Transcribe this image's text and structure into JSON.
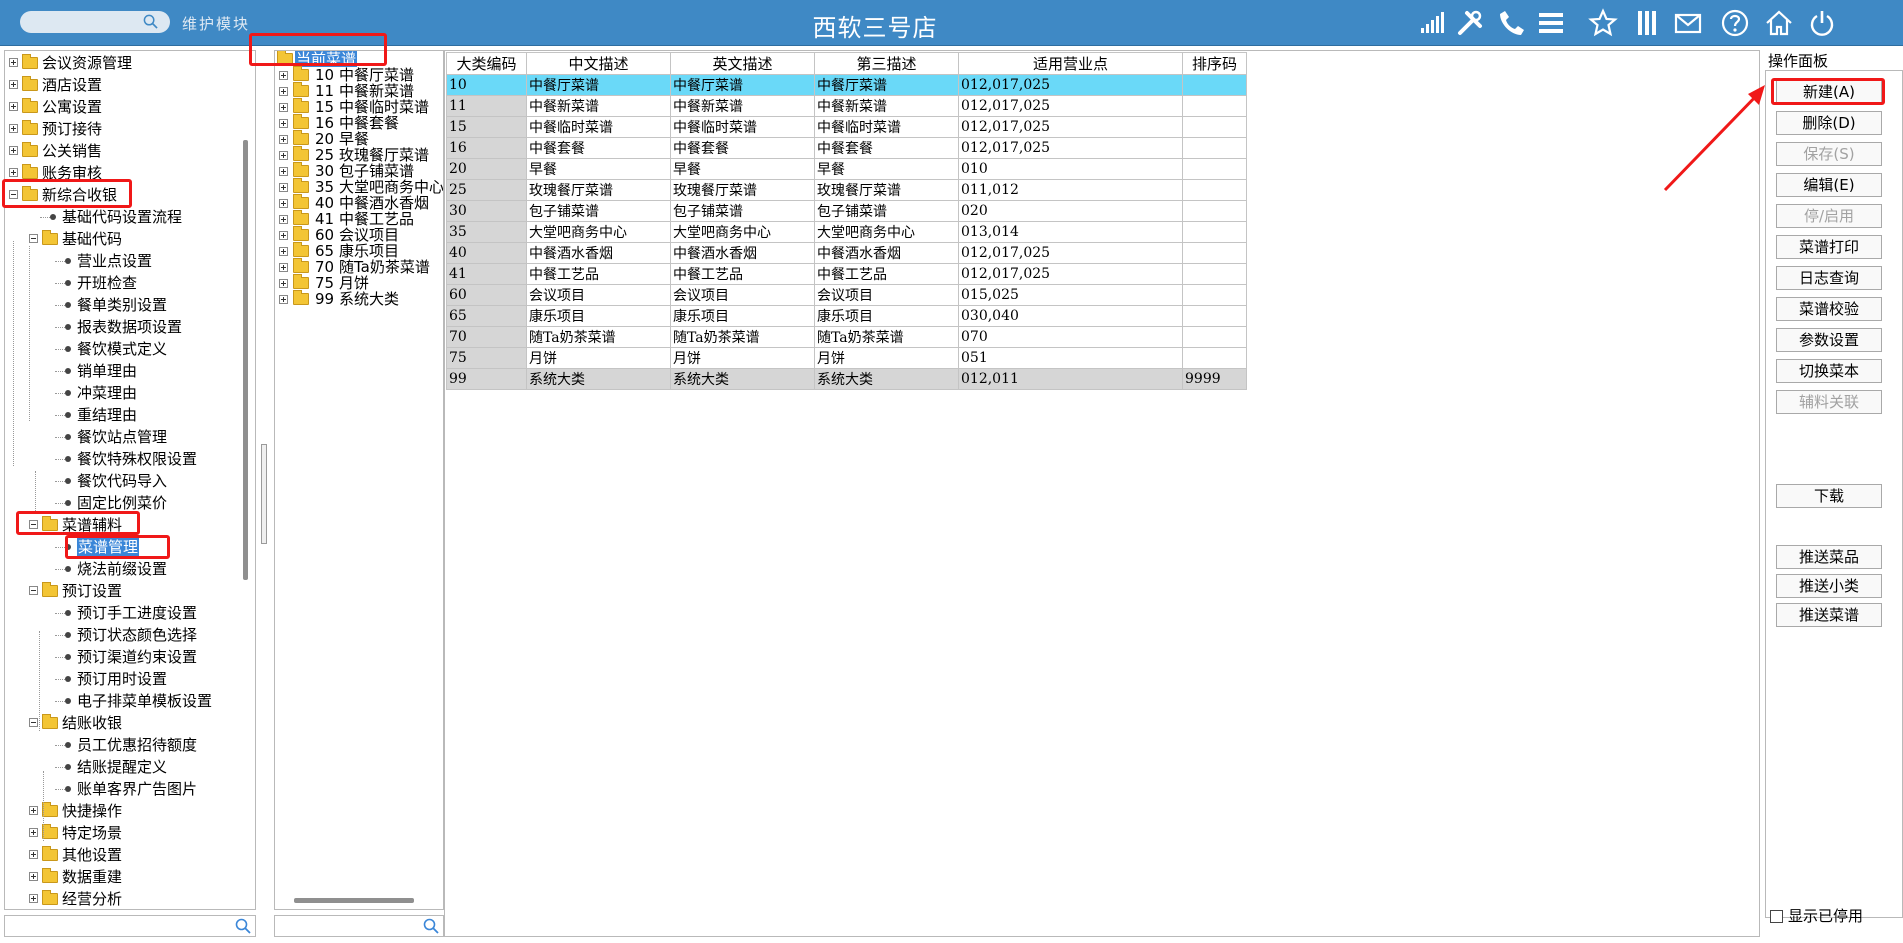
{
  "header": {
    "title": "西软三号店",
    "module_label": "维护模块",
    "icons": [
      "signal-icon",
      "tools-icon",
      "phone-icon",
      "menu-icon",
      "star-icon",
      "columns-icon",
      "mail-icon",
      "help-icon",
      "home-icon",
      "power-icon"
    ]
  },
  "left_tree": {
    "items": [
      {
        "label": "会议资源管理",
        "expanded": false
      },
      {
        "label": "酒店设置",
        "expanded": false
      },
      {
        "label": "公寓设置",
        "expanded": false
      },
      {
        "label": "预订接待",
        "expanded": false
      },
      {
        "label": "公关销售",
        "expanded": false
      },
      {
        "label": "账务审核",
        "expanded": false
      },
      {
        "label": "新综合收银",
        "expanded": true
      },
      {
        "label": "基础代码设置流程"
      },
      {
        "label": "基础代码",
        "expanded": true
      },
      {
        "label": "营业点设置"
      },
      {
        "label": "开班检查"
      },
      {
        "label": "餐单类别设置"
      },
      {
        "label": "报表数据项设置"
      },
      {
        "label": "餐饮模式定义"
      },
      {
        "label": "销单理由"
      },
      {
        "label": "冲菜理由"
      },
      {
        "label": "重结理由"
      },
      {
        "label": "餐饮站点管理"
      },
      {
        "label": "餐饮特殊权限设置"
      },
      {
        "label": "餐饮代码导入"
      },
      {
        "label": "固定比例菜价"
      },
      {
        "label": "菜谱辅料",
        "expanded": true
      },
      {
        "label": "菜谱管理",
        "selected": true
      },
      {
        "label": "烧法前缀设置"
      },
      {
        "label": "预订设置",
        "expanded": true
      },
      {
        "label": "预订手工进度设置"
      },
      {
        "label": "预订状态颜色选择"
      },
      {
        "label": "预订渠道约束设置"
      },
      {
        "label": "预订用时设置"
      },
      {
        "label": "电子排菜单模板设置"
      },
      {
        "label": "结账收银",
        "expanded": true
      },
      {
        "label": "员工优惠招待额度"
      },
      {
        "label": "结账提醒定义"
      },
      {
        "label": "账单客界广告图片"
      },
      {
        "label": "快捷操作",
        "expanded": false
      },
      {
        "label": "特定场景",
        "expanded": false
      },
      {
        "label": "其他设置",
        "expanded": false
      },
      {
        "label": "数据重建",
        "expanded": false
      },
      {
        "label": "经营分析",
        "expanded": false
      }
    ]
  },
  "menu_tree": {
    "root_label": "当前菜谱",
    "items": [
      {
        "code": "10",
        "name": "中餐厅菜谱"
      },
      {
        "code": "11",
        "name": "中餐新菜谱"
      },
      {
        "code": "15",
        "name": "中餐临时菜谱"
      },
      {
        "code": "16",
        "name": "中餐套餐"
      },
      {
        "code": "20",
        "name": "早餐"
      },
      {
        "code": "25",
        "name": "玫瑰餐厅菜谱"
      },
      {
        "code": "30",
        "name": "包子铺菜谱"
      },
      {
        "code": "35",
        "name": "大堂吧商务中心"
      },
      {
        "code": "40",
        "name": "中餐酒水香烟"
      },
      {
        "code": "41",
        "name": "中餐工艺品"
      },
      {
        "code": "60",
        "name": "会议项目"
      },
      {
        "code": "65",
        "name": "康乐项目"
      },
      {
        "code": "70",
        "name": "随Ta奶茶菜谱"
      },
      {
        "code": "75",
        "name": "月饼"
      },
      {
        "code": "99",
        "name": "系统大类"
      }
    ]
  },
  "table": {
    "columns": [
      "大类编码",
      "中文描述",
      "英文描述",
      "第三描述",
      "适用营业点",
      "排序码"
    ],
    "rows": [
      [
        "10",
        "中餐厅菜谱",
        "中餐厅菜谱",
        "中餐厅菜谱",
        "012,017,025",
        ""
      ],
      [
        "11",
        "中餐新菜谱",
        "中餐新菜谱",
        "中餐新菜谱",
        "012,017,025",
        ""
      ],
      [
        "15",
        "中餐临时菜谱",
        "中餐临时菜谱",
        "中餐临时菜谱",
        "012,017,025",
        ""
      ],
      [
        "16",
        "中餐套餐",
        "中餐套餐",
        "中餐套餐",
        "012,017,025",
        ""
      ],
      [
        "20",
        "早餐",
        "早餐",
        "早餐",
        "010",
        ""
      ],
      [
        "25",
        "玫瑰餐厅菜谱",
        "玫瑰餐厅菜谱",
        "玫瑰餐厅菜谱",
        "011,012",
        ""
      ],
      [
        "30",
        "包子铺菜谱",
        "包子铺菜谱",
        "包子铺菜谱",
        "020",
        ""
      ],
      [
        "35",
        "大堂吧商务中心",
        "大堂吧商务中心",
        "大堂吧商务中心",
        "013,014",
        ""
      ],
      [
        "40",
        "中餐酒水香烟",
        "中餐酒水香烟",
        "中餐酒水香烟",
        "012,017,025",
        ""
      ],
      [
        "41",
        "中餐工艺品",
        "中餐工艺品",
        "中餐工艺品",
        "012,017,025",
        ""
      ],
      [
        "60",
        "会议项目",
        "会议项目",
        "会议项目",
        "015,025",
        ""
      ],
      [
        "65",
        "康乐项目",
        "康乐项目",
        "康乐项目",
        "030,040",
        ""
      ],
      [
        "70",
        "随Ta奶茶菜谱",
        "随Ta奶茶菜谱",
        "随Ta奶茶菜谱",
        "070",
        ""
      ],
      [
        "75",
        "月饼",
        "月饼",
        "月饼",
        "051",
        ""
      ],
      [
        "99",
        "系统大类",
        "系统大类",
        "系统大类",
        "012,011",
        "9999"
      ]
    ],
    "selected_row": 0
  },
  "operation_panel": {
    "title": "操作面板",
    "buttons": [
      {
        "label": "新建(A)",
        "enabled": true
      },
      {
        "label": "删除(D)",
        "enabled": true
      },
      {
        "label": "保存(S)",
        "enabled": false
      },
      {
        "label": "编辑(E)",
        "enabled": true
      },
      {
        "label": "停/启用",
        "enabled": false
      },
      {
        "label": "菜谱打印",
        "enabled": true
      },
      {
        "label": "日志查询",
        "enabled": true
      },
      {
        "label": "菜谱校验",
        "enabled": true
      },
      {
        "label": "参数设置",
        "enabled": true
      },
      {
        "label": "切换菜本",
        "enabled": true
      },
      {
        "label": "辅料关联",
        "enabled": false
      },
      {
        "label": "下载",
        "enabled": true
      },
      {
        "label": "推送菜品",
        "enabled": true
      },
      {
        "label": "推送小类",
        "enabled": true
      },
      {
        "label": "推送菜谱",
        "enabled": true
      }
    ],
    "show_disabled_label": "显示已停用",
    "show_disabled_checked": false
  },
  "colors": {
    "header": "#3f89c5",
    "selection_blue": "#3a86d8",
    "row_highlight": "#6ad9f8",
    "annotation_red": "#f01818"
  }
}
